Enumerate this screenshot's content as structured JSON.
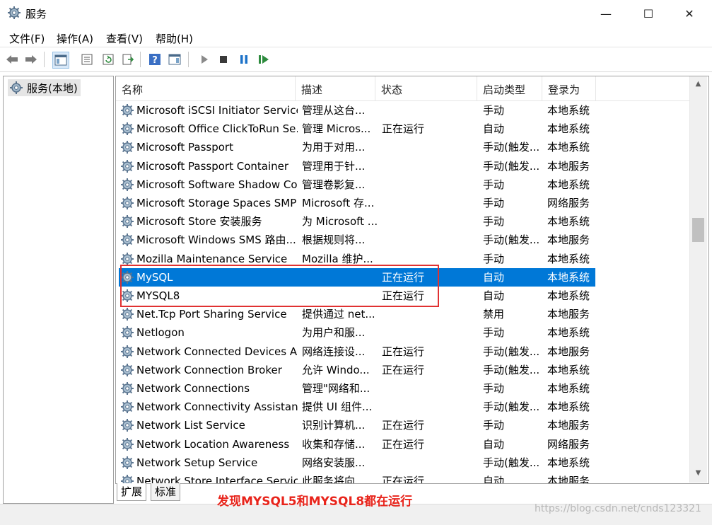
{
  "window": {
    "title": "服务",
    "minimize": "—",
    "maximize": "☐",
    "close": "✕"
  },
  "menu": [
    "文件(F)",
    "操作(A)",
    "查看(V)",
    "帮助(H)"
  ],
  "tree": {
    "root": "服务(本地)"
  },
  "columns": [
    "名称",
    "描述",
    "状态",
    "启动类型",
    "登录为"
  ],
  "services": [
    {
      "name": "Microsoft iSCSI Initiator Service",
      "desc": "管理从这台...",
      "status": "",
      "start": "手动",
      "logon": "本地系统"
    },
    {
      "name": "Microsoft Office ClickToRun Se...",
      "desc": "管理 Micros...",
      "status": "正在运行",
      "start": "自动",
      "logon": "本地系统"
    },
    {
      "name": "Microsoft Passport",
      "desc": "为用于对用...",
      "status": "",
      "start": "手动(触发...",
      "logon": "本地系统"
    },
    {
      "name": "Microsoft Passport Container",
      "desc": "管理用于针...",
      "status": "",
      "start": "手动(触发...",
      "logon": "本地服务"
    },
    {
      "name": "Microsoft Software Shadow Co...",
      "desc": "管理卷影复...",
      "status": "",
      "start": "手动",
      "logon": "本地系统"
    },
    {
      "name": "Microsoft Storage Spaces SMP",
      "desc": "Microsoft 存...",
      "status": "",
      "start": "手动",
      "logon": "网络服务"
    },
    {
      "name": "Microsoft Store 安装服务",
      "desc": "为 Microsoft ...",
      "status": "",
      "start": "手动",
      "logon": "本地系统"
    },
    {
      "name": "Microsoft Windows SMS 路由...",
      "desc": "根据规则将...",
      "status": "",
      "start": "手动(触发...",
      "logon": "本地服务"
    },
    {
      "name": "Mozilla Maintenance Service",
      "desc": "Mozilla 维护...",
      "status": "",
      "start": "手动",
      "logon": "本地系统"
    },
    {
      "name": "MySQL",
      "desc": "",
      "status": "正在运行",
      "start": "自动",
      "logon": "本地系统",
      "selected": true
    },
    {
      "name": "MYSQL8",
      "desc": "",
      "status": "正在运行",
      "start": "自动",
      "logon": "本地系统"
    },
    {
      "name": "Net.Tcp Port Sharing Service",
      "desc": "提供通过 net...",
      "status": "",
      "start": "禁用",
      "logon": "本地服务"
    },
    {
      "name": "Netlogon",
      "desc": "为用户和服...",
      "status": "",
      "start": "手动",
      "logon": "本地系统"
    },
    {
      "name": "Network Connected Devices A...",
      "desc": "网络连接设...",
      "status": "正在运行",
      "start": "手动(触发...",
      "logon": "本地服务"
    },
    {
      "name": "Network Connection Broker",
      "desc": "允许 Windo...",
      "status": "正在运行",
      "start": "手动(触发...",
      "logon": "本地系统"
    },
    {
      "name": "Network Connections",
      "desc": "管理\"网络和...",
      "status": "",
      "start": "手动",
      "logon": "本地系统"
    },
    {
      "name": "Network Connectivity Assistant",
      "desc": "提供 UI 组件...",
      "status": "",
      "start": "手动(触发...",
      "logon": "本地系统"
    },
    {
      "name": "Network List Service",
      "desc": "识别计算机...",
      "status": "正在运行",
      "start": "手动",
      "logon": "本地服务"
    },
    {
      "name": "Network Location Awareness",
      "desc": "收集和存储...",
      "status": "正在运行",
      "start": "自动",
      "logon": "网络服务"
    },
    {
      "name": "Network Setup Service",
      "desc": "网络安装服...",
      "status": "",
      "start": "手动(触发...",
      "logon": "本地系统"
    },
    {
      "name": "Network Store Interface Service",
      "desc": "此服务将向...",
      "status": "正在运行",
      "start": "自动",
      "logon": "本地服务"
    }
  ],
  "tabs": [
    "扩展",
    "标准"
  ],
  "annotation": "发现MYSQL5和MYSQL8都在运行",
  "watermark": "https://blog.csdn.net/cnds123321",
  "colors": {
    "selection": "#0078d7",
    "annotation_red": "#e8241b",
    "highlight_box": "#e03131"
  }
}
